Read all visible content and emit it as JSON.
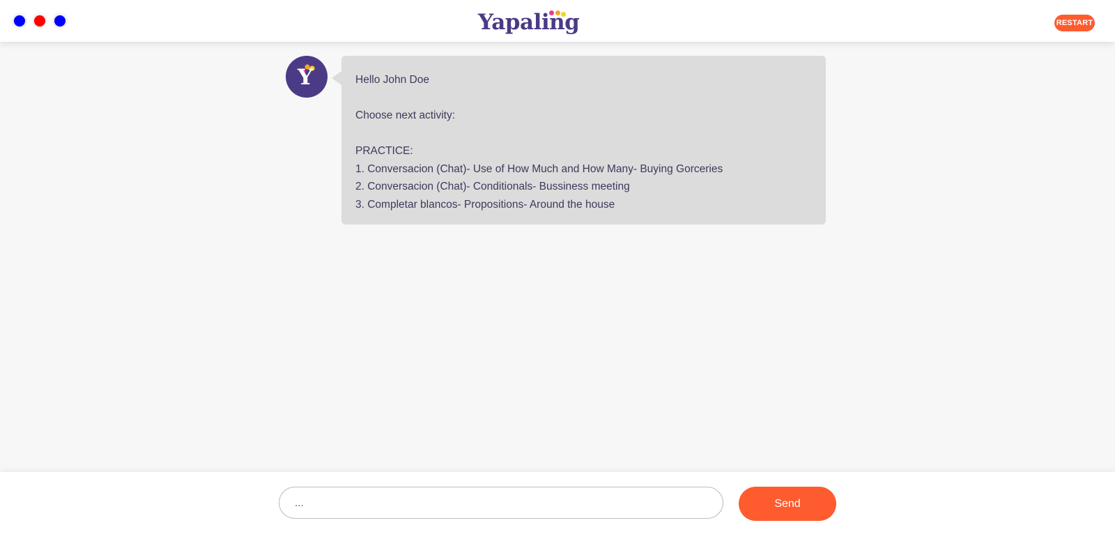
{
  "header": {
    "window_dots": [
      {
        "name": "dot-1",
        "color": "#0000ff"
      },
      {
        "name": "dot-2",
        "color": "#ff0000"
      },
      {
        "name": "dot-3",
        "color": "#0000ff"
      }
    ],
    "logo_text": "Yapaling",
    "logo_dot_colors": [
      "#e63c8c",
      "#f5a623",
      "#f7d21e"
    ],
    "restart_label": "RESTART"
  },
  "chat": {
    "avatar_letter": "Y",
    "avatar_dot_colors": [
      "#e63c8c",
      "#f5a623",
      "#f7d21e"
    ],
    "message": {
      "greeting": "Hello John Doe",
      "prompt": "Choose next activity:",
      "section": "PRACTICE:",
      "options": [
        "1. Conversacion (Chat)- Use of How Much and How Many- Buying Gorceries",
        "2. Conversacion (Chat)- Conditionals- Bussiness meeting",
        "3. Completar blancos- Propositions- Around the house"
      ]
    }
  },
  "composer": {
    "placeholder": "...",
    "value": "",
    "send_label": "Send"
  },
  "colors": {
    "brand_purple": "#4b3b86",
    "accent_orange": "#fe5b2f",
    "bubble_bg": "#dcdcdc",
    "page_bg": "#f7f7f7"
  }
}
